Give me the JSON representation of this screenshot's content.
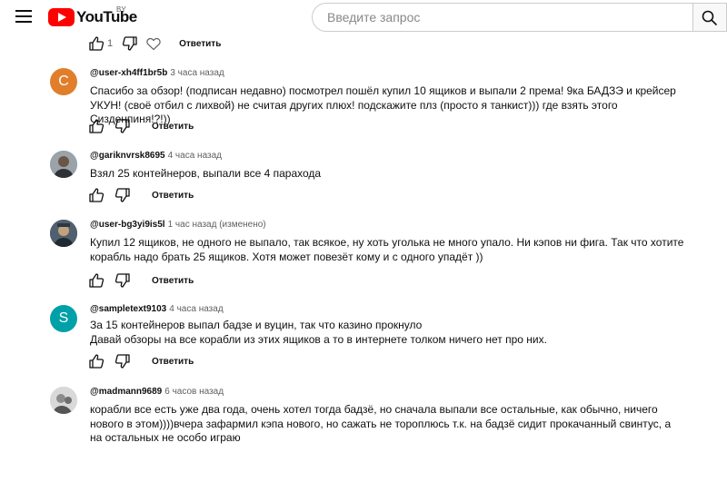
{
  "header": {
    "logo_text": "YouTube",
    "country_code": "BY",
    "search_placeholder": "Введите запрос"
  },
  "top_actions": {
    "like_count": "1",
    "reply_label": "Ответить"
  },
  "comments": [
    {
      "author": "@user-xh4ff1br5b",
      "time": "3 часа назад",
      "avatar_letter": "C",
      "avatar_color": "#e07e2c",
      "text": "Спасибо за обзор! (подписан недавно) посмотрел пошёл купил 10 ящиков и выпали 2 према! 9ка БАДЗЭ и крейсер УКУН! (своё отбил с лихвой) не считая других плюх!  подскажите плз (просто я танкист))) где взять этого Сизденпиня!?!))",
      "reply_label": "Ответить"
    },
    {
      "author": "@gariknvrsk8695",
      "time": "4 часа назад",
      "text": "Взял 25 контейнеров, выпали все 4 парахода",
      "reply_label": "Ответить"
    },
    {
      "author": "@user-bg3yi9is5l",
      "time": "1 час назад (изменено)",
      "text": "Купил 12 ящиков, не одного не  выпало, так всякое, ну хоть уголька не много упало. Ни кэпов ни фига. Так что хотите корабль надо брать 25 ящиков. Хотя может повезёт кому и с одного упадёт ))",
      "reply_label": "Ответить"
    },
    {
      "author": "@sampletext9103",
      "time": "4 часа назад",
      "avatar_letter": "S",
      "avatar_color": "#00a0a8",
      "text_lines": [
        "За 15 контейнеров выпал бадзе и вуцин, так что казино прокнуло",
        "Давай обзоры на все корабли из этих ящиков а то в интернете толком ничего нет про них."
      ],
      "reply_label": "Ответить"
    },
    {
      "author": "@madmann9689",
      "time": "6 часов назад",
      "text": "корабли все есть уже два года, очень хотел тогда бадзё, но сначала выпали все остальные, как обычно, ничего нового в этом))))вчера зафармил кэпа нового, но сажать не тороплюсь т.к. на бадзё сидит прокачанный свинтус, а на остальных не особо играю"
    }
  ]
}
